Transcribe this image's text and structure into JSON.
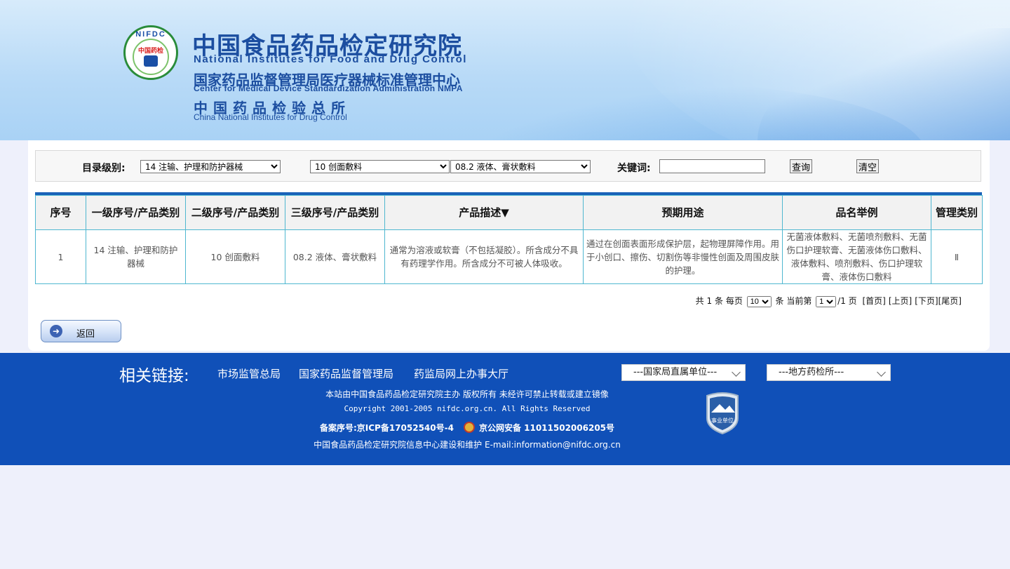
{
  "header": {
    "logo_ring_text": "NIFDC",
    "logo_red_text": "中国药检",
    "title_cn": "中国食品药品检定研究院",
    "title_en": "National Institutes for Food and Drug Control",
    "sub_cn": "国家药品监督管理局医疗器械标准管理中心",
    "sub_en": "Center for Medical Device Standardization Administration NMPA",
    "sub2_cn": "中国药品检验总所",
    "sub2_en": "China National Institutes for Drug Control"
  },
  "filter": {
    "level_label": "目录级别:",
    "level1_value": "14  注输、护理和防护器械",
    "level2_value": "10  创面敷料",
    "level3_value": "08.2  液体、膏状敷料",
    "keyword_label": "关键词:",
    "keyword_value": "",
    "search_label": "查询",
    "clear_label": "清空"
  },
  "table": {
    "headers": [
      "序号",
      "一级序号/产品类别",
      "二级序号/产品类别",
      "三级序号/产品类别",
      "产品描述▼",
      "预期用途",
      "品名举例",
      "管理类别"
    ],
    "rows": [
      {
        "no": "1",
        "level1": "14 注输、护理和防护器械",
        "level2": "10 创面敷料",
        "level3": "08.2 液体、膏状敷料",
        "description": "通常为溶液或软膏（不包括凝胶）。所含成分不具有药理学作用。所含成分不可被人体吸收。",
        "usage": "通过在创面表面形成保护层，起物理屏障作用。用于小创口、擦伤、切割伤等非慢性创面及周围皮肤的护理。",
        "examples": "无菌液体敷料、无菌喷剂敷料、无菌伤口护理软膏、无菌液体伤口敷料、液体敷料、喷剂敷料、伤口护理软膏、液体伤口敷料",
        "class": "Ⅱ"
      }
    ]
  },
  "pager": {
    "total_prefix": "共",
    "total": "1",
    "unit": "条",
    "per_page_label": "每页",
    "per_page": "10",
    "current_label": "当前第",
    "current": "1",
    "of_pages": "/1 页",
    "first": "[首页]",
    "prev": "[上页]",
    "next": "[下页]",
    "last": "[尾页]"
  },
  "back": {
    "label": "返回",
    "icon": "arrow-left-circle-icon"
  },
  "footer": {
    "related_label": "相关链接:",
    "links": [
      "市场监管总局",
      "国家药品监督管理局",
      "药监局网上办事大厅"
    ],
    "select1": "---国家局直属单位---",
    "select2": "---地方药检所---",
    "line1": "本站由中国食品药品检定研究院主办 版权所有 未经许可禁止转载或建立镜像",
    "line2": "Copyright 2001-2005 nifdc.org.cn. All Rights Reserved",
    "icp": "备案序号:京ICP备17052540号-4",
    "police": "京公网安备 11011502006205号",
    "line4": "中国食品药品检定研究院信息中心建设和维护  E-mail:information@nifdc.org.cn",
    "badge_text": "事业单位"
  },
  "colors": {
    "header_blue": "#1c4ea0",
    "footer_bg": "#1050b8",
    "table_border": "#4fb7d0",
    "rule_blue": "#1a62b8"
  }
}
